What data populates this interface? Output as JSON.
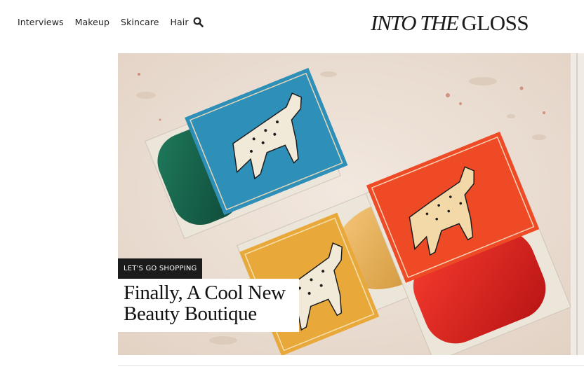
{
  "nav": {
    "links": [
      "Interviews",
      "Makeup",
      "Skincare",
      "Hair"
    ],
    "search_icon": "search-icon"
  },
  "logo": {
    "italic_part": "INTO THE",
    "plain_part": "GLOSS"
  },
  "feature": {
    "category": "LET'S GO SHOPPING",
    "title": "Finally, A Cool New Beauty Boutique",
    "image": "soap-boxes-with-leopard-illustrations"
  },
  "colors": {
    "badge_bg": "#1b1b1b",
    "text": "#111111",
    "stone": "#ecdfd3"
  }
}
